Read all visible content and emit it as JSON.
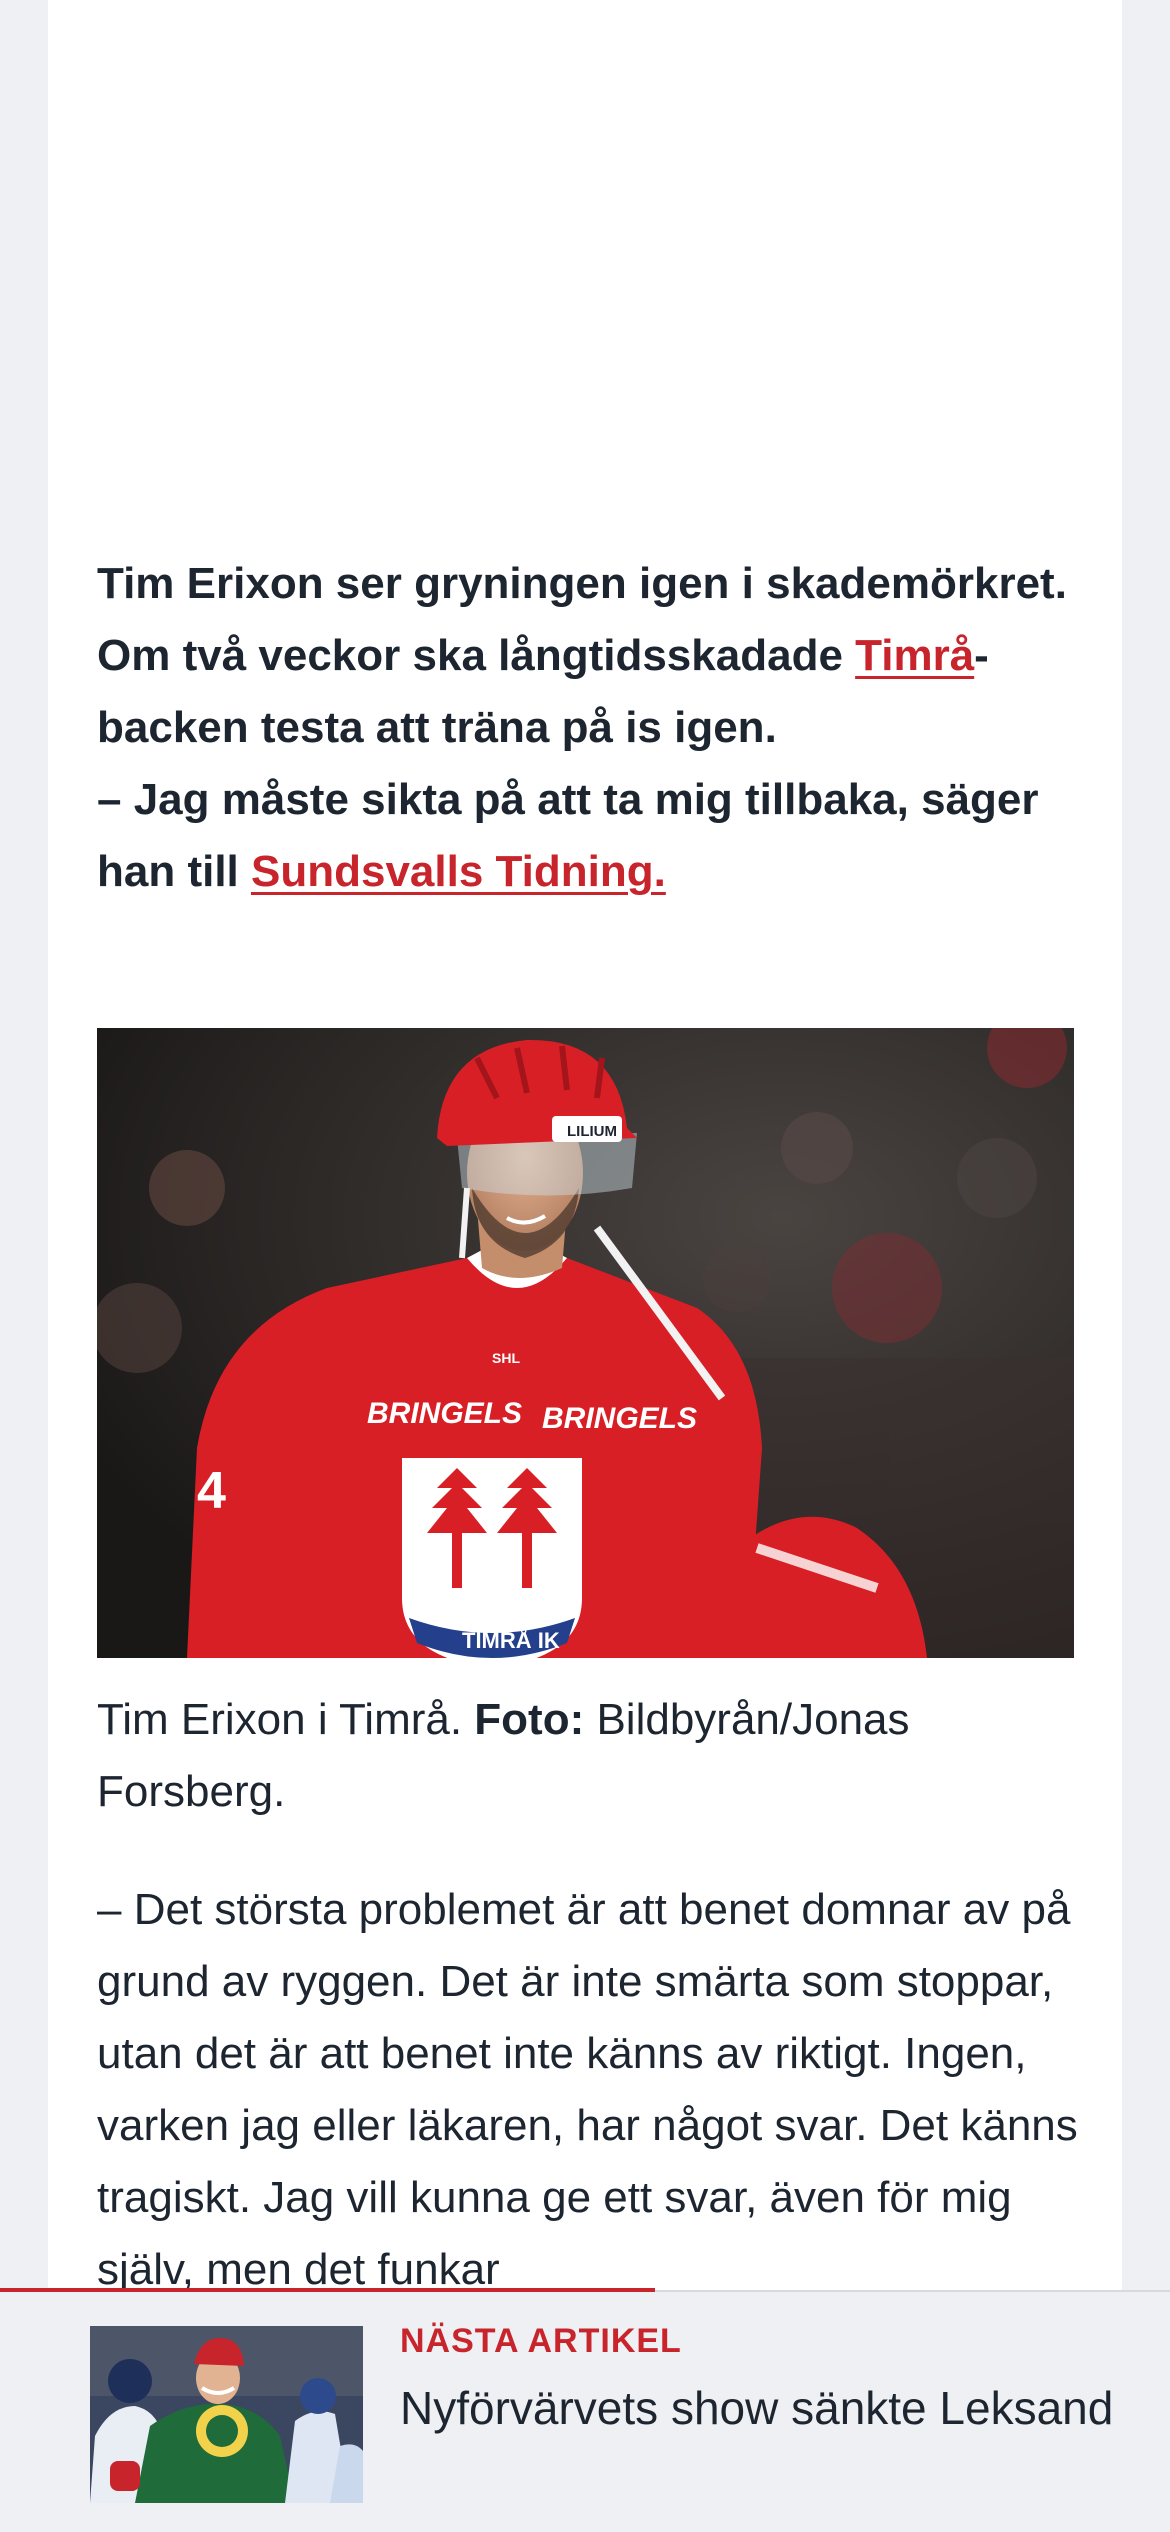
{
  "lead": {
    "line1": "Tim Erixon ser gryningen igen i skademörkret.",
    "line2_before": "Om två veckor ska långtidsskadade ",
    "line2_link": "Timrå",
    "line2_after": "-backen testa att träna på is igen.",
    "line3_before": "– Jag måste sikta på att ta mig tillbaka, säger han till ",
    "line3_link": "Sundsvalls Tidning."
  },
  "photo": {
    "jersey_sponsor_left": "BRINGELS",
    "jersey_sponsor_right": "BRINGELS",
    "jersey_number": "4",
    "crest_text": "TIMRÅ IK",
    "helmet_sponsor": "LILIUM",
    "league_patch": "SHL",
    "colors": {
      "jersey": "#d91f26",
      "background": "#24211f"
    }
  },
  "caption": {
    "text": "Tim Erixon i Timrå. ",
    "credit_label": "Foto:",
    "credit_value": " Bildbyrån/Jonas Forsberg."
  },
  "body": {
    "paragraph1": "– Det största problemet är att benet domnar av på grund av ryggen. Det är inte smärta som stoppar, utan det är att benet inte känns av riktigt. Ingen, varken jag eller läkaren, har något svar. Det känns tragiskt. Jag vill kunna ge ett svar, även för mig själv, men det funkar"
  },
  "next_article": {
    "label": "NÄSTA ARTIKEL",
    "title": "Nyförvärvets show sänkte Leksand",
    "reading_progress": 0.56
  }
}
